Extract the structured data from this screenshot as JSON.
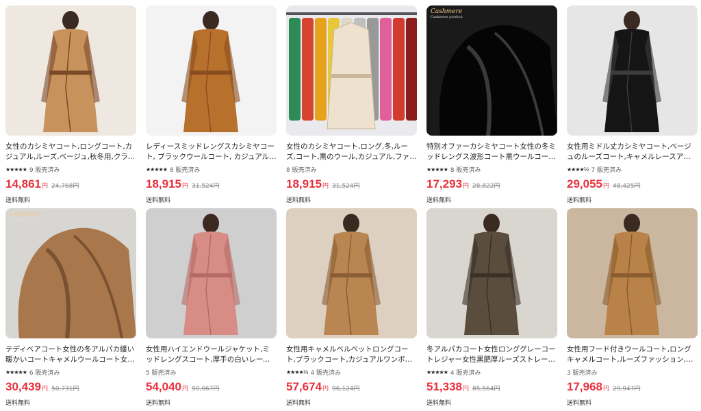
{
  "colors": {
    "price": "#e8303c",
    "text": "#222222",
    "muted": "#666666"
  },
  "products": [
    {
      "title": "女性のカシミヤコート,ロングコート,カジュアル,ルーズ,ベージュ,秋冬用,クラシック",
      "stars": "★★★★★",
      "sold": "9 販売済み",
      "price": "14,861",
      "yen": "円",
      "orig": "24,768円",
      "ship": "送料無料",
      "bg": "#efe8e0",
      "coat": "#c8925d",
      "accent": "#7a4a28",
      "icon": "camel-coat-photo"
    },
    {
      "title": "レディースミッドレングスカシミヤコート, ブラックウールコート, カジュアルファッション, レッド, ベージュ",
      "stars": "★★★★★",
      "sold": "8 販売済み",
      "price": "18,915",
      "yen": "円",
      "orig": "31,524円",
      "ship": "送料無料",
      "bg": "#f3f3f3",
      "coat": "#b8702d",
      "accent": "#8a4e1e",
      "icon": "brown-coat-photo"
    },
    {
      "title": "女性のカシミヤコート,ロング,冬,ルーズ,コート,黒のウール,カジュアル,ファッショナブル,赤,秋",
      "stars": "",
      "sold": "8 販売済み",
      "price": "18,915",
      "yen": "円",
      "orig": "31,524円",
      "ship": "送料無料",
      "bg": "#e9e9ee",
      "coat": "#eee2cf",
      "accent": "#c9b79c",
      "icon": "color-variety-photo"
    },
    {
      "title": "特別オファーカシミヤコート女性の冬ミッドレングス波形コート黒ウールコート女性秋の新カジュアル",
      "stars": "★★★★★",
      "sold": "8 販売済み",
      "price": "17,293",
      "yen": "円",
      "orig": "28,822円",
      "ship": "送料無料",
      "bg": "#1a1a1a",
      "coat": "#050505",
      "accent": "#3a3a3a",
      "icon": "black-cashmere-photo",
      "badge": "Cashmere",
      "badge_sub": "Cashmere product"
    },
    {
      "title": "女性用ミドル丈カシミヤコート,ベージュのルーズコート,キャメルレースアップ,ダブルブレスト,クラシック",
      "stars": "★★★★½",
      "sold": "7 販売済み",
      "price": "29,055",
      "yen": "円",
      "orig": "48,425円",
      "ship": "送料無料",
      "bg": "#e6e6e6",
      "coat": "#151515",
      "accent": "#3c3c3c",
      "icon": "black-coat-photo"
    },
    {
      "title": "テディベアコート女性の冬アルパカ緩い暖かいコートキャメルウールコート女性のクラシックカジュアル",
      "stars": "★★★★★",
      "sold": "6 販売済み",
      "price": "30,439",
      "yen": "円",
      "orig": "50,731円",
      "ship": "送料無料",
      "bg": "#d8d6d3",
      "coat": "#a8774c",
      "accent": "#7a5231",
      "icon": "teddy-coat-photo",
      "badge": "Cashmere",
      "badge_sub": "Cashmere product"
    },
    {
      "title": "女性用ハイエンドウールジャケット,ミッドレングスコート,厚手の白いレースアップ,ウォーム,ダブルブレスト",
      "stars": "",
      "sold": "5 販売済み",
      "price": "54,040",
      "yen": "円",
      "orig": "90,067円",
      "ship": "送料無料",
      "bg": "#cfcfcf",
      "coat": "#d88c86",
      "accent": "#b56a66",
      "icon": "pink-coat-photo"
    },
    {
      "title": "女性用キャメルベルベットロングコート,ブラックコート,カジュアルワンボタン,ウォームファッションスタイル",
      "stars": "★★★★½",
      "sold": "4 販売済み",
      "price": "57,674",
      "yen": "円",
      "orig": "96,124円",
      "ship": "送料無料",
      "bg": "#ddd0c0",
      "coat": "#b98551",
      "accent": "#8a5d34",
      "icon": "camel-velvet-coat-photo"
    },
    {
      "title": "冬アルパカコート女性ロンググレーコートレジャー女性黒肥厚ルーズストレートタイプダブルブレスト",
      "stars": "★★★★★",
      "sold": "4 販売済み",
      "price": "51,338",
      "yen": "円",
      "orig": "85,564円",
      "ship": "送料無料",
      "bg": "#d9d5cf",
      "coat": "#5a4d3e",
      "accent": "#3b3026",
      "icon": "grey-coat-photo"
    },
    {
      "title": "女性用フード付きウールコート,ロングキャメルコート,ルーズファッション,カジュアルブラックストラップ",
      "stars": "",
      "sold": "3 販売済み",
      "price": "17,968",
      "yen": "円",
      "orig": "29,947円",
      "ship": "送料無料",
      "bg": "#cbb79f",
      "coat": "#b88248",
      "accent": "#8b5c2c",
      "icon": "hooded-coat-photo"
    }
  ]
}
